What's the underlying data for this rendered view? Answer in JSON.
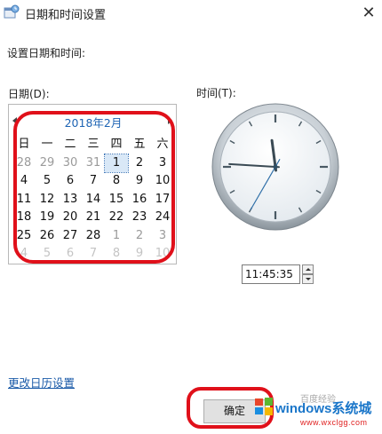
{
  "window": {
    "title": "日期和时间设置",
    "close_glyph": "✕"
  },
  "labels": {
    "set_date_time": "设置日期和时间:",
    "date": "日期(D):",
    "time": "时间(T):"
  },
  "calendar": {
    "month_title": "2018年2月",
    "weekdays": [
      "日",
      "一",
      "二",
      "三",
      "四",
      "五",
      "六"
    ],
    "weeks": [
      [
        {
          "d": "28",
          "m": "other"
        },
        {
          "d": "29",
          "m": "other"
        },
        {
          "d": "30",
          "m": "other"
        },
        {
          "d": "31",
          "m": "other"
        },
        {
          "d": "1",
          "m": "selected"
        },
        {
          "d": "2",
          "m": "cur"
        },
        {
          "d": "3",
          "m": "cur"
        }
      ],
      [
        {
          "d": "4",
          "m": "cur"
        },
        {
          "d": "5",
          "m": "cur"
        },
        {
          "d": "6",
          "m": "cur"
        },
        {
          "d": "7",
          "m": "cur"
        },
        {
          "d": "8",
          "m": "cur"
        },
        {
          "d": "9",
          "m": "cur"
        },
        {
          "d": "10",
          "m": "cur"
        }
      ],
      [
        {
          "d": "11",
          "m": "cur"
        },
        {
          "d": "12",
          "m": "cur"
        },
        {
          "d": "13",
          "m": "cur"
        },
        {
          "d": "14",
          "m": "cur"
        },
        {
          "d": "15",
          "m": "cur"
        },
        {
          "d": "16",
          "m": "cur"
        },
        {
          "d": "17",
          "m": "cur"
        }
      ],
      [
        {
          "d": "18",
          "m": "cur"
        },
        {
          "d": "19",
          "m": "cur"
        },
        {
          "d": "20",
          "m": "cur"
        },
        {
          "d": "21",
          "m": "cur"
        },
        {
          "d": "22",
          "m": "cur"
        },
        {
          "d": "23",
          "m": "cur"
        },
        {
          "d": "24",
          "m": "cur"
        }
      ],
      [
        {
          "d": "25",
          "m": "cur"
        },
        {
          "d": "26",
          "m": "cur"
        },
        {
          "d": "27",
          "m": "cur"
        },
        {
          "d": "28",
          "m": "cur"
        },
        {
          "d": "1",
          "m": "other"
        },
        {
          "d": "2",
          "m": "other"
        },
        {
          "d": "3",
          "m": "other"
        }
      ],
      [
        {
          "d": "4",
          "m": "faded"
        },
        {
          "d": "5",
          "m": "faded"
        },
        {
          "d": "6",
          "m": "faded"
        },
        {
          "d": "7",
          "m": "faded"
        },
        {
          "d": "8",
          "m": "faded"
        },
        {
          "d": "9",
          "m": "faded"
        },
        {
          "d": "10",
          "m": "faded"
        }
      ]
    ]
  },
  "clock": {
    "hour": 11,
    "minute": 45,
    "second": 35
  },
  "time_field": {
    "value": "11:45:35"
  },
  "links": {
    "change_calendar": "更改日历设置"
  },
  "buttons": {
    "ok": "确定"
  },
  "watermark": {
    "text": "windows系统城",
    "url": "www.wxclgg.com",
    "brand": "百度经验"
  },
  "colors": {
    "accent": "#1e64b4",
    "annotation": "#e0101a",
    "link": "#1a5aa8"
  }
}
